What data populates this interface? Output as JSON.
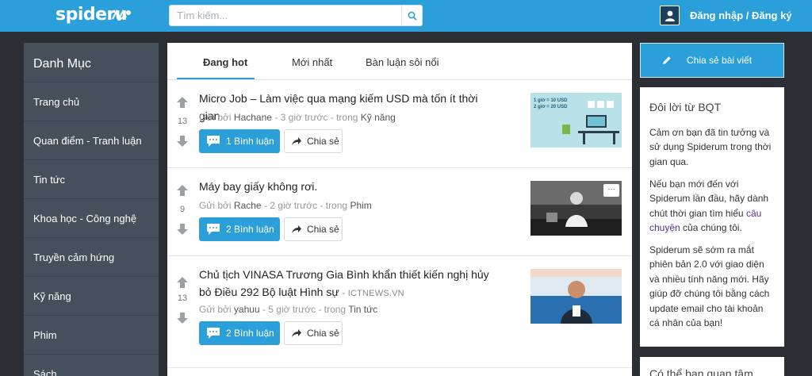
{
  "header": {
    "logo_text": "spideru",
    "search_placeholder": "Tìm kiếm...",
    "search_icon": "search-icon",
    "user_icon": "user-avatar-icon",
    "login_label": "Đăng nhập / Đăng ký",
    "brand_color": "#2b9fd9"
  },
  "sidebar": {
    "title": "Danh Mục",
    "items": [
      {
        "label": "Trang chủ"
      },
      {
        "label": "Quan điểm - Tranh luận"
      },
      {
        "label": "Tin tức"
      },
      {
        "label": "Khoa học - Công nghệ"
      },
      {
        "label": "Truyền cảm hứng"
      },
      {
        "label": "Kỹ năng"
      },
      {
        "label": "Phim"
      },
      {
        "label": "Sách"
      }
    ]
  },
  "tabs": [
    {
      "label": "Đang hot",
      "active": true
    },
    {
      "label": "Mới nhất",
      "active": false
    },
    {
      "label": "Bàn luận sôi nổi",
      "active": false
    }
  ],
  "posts": [
    {
      "title": "Micro Job – Làm việc qua mạng kiếm USD mà tốn ít thời gian",
      "votes": "13",
      "by_label": "Gửi bởi",
      "author": "Hachane",
      "time": "- 3 giờ trước - trong",
      "category": "Kỹ năng",
      "comments_label": "1 Bình luận",
      "share_label": "Chia sẻ",
      "thumb_text_1": "1 giờ = 10 USD",
      "thumb_text_2": "2 giờ = 20 USD"
    },
    {
      "title": "Máy bay giấy không rơi.",
      "votes": "9",
      "by_label": "Gửi bởi",
      "author": "Rache",
      "time": "- 2 giờ trước - trong",
      "category": "Phim",
      "comments_label": "2 Bình luận",
      "share_label": "Chia sẻ",
      "thumb_more": "···"
    },
    {
      "title": "Chủ tịch VINASA Trương Gia Bình khẩn thiết kiến nghị hủy bỏ Điều 292 Bộ luật Hình sự",
      "source": "- ICTNEWS.VN",
      "votes": "13",
      "by_label": "Gửi bởi",
      "author": "yahuu",
      "time": "- 5 giờ trước - trong",
      "category": "Tin tức",
      "comments_label": "2 Bình luận",
      "share_label": "Chia sẻ"
    }
  ],
  "right": {
    "share_post_label": "Chia sẻ bài viết",
    "bqt_title": "Đôi lời từ BQT",
    "p1_lines": [
      "Cảm ơn bạn đã tin tưởng và",
      "sử dụng Spiderum trong thời",
      "gian qua."
    ],
    "p2_lines": [
      "Nếu bạn mới đến với",
      "Spiderum lần đầu, hãy dành",
      "chút thời gian tìm hiểu"
    ],
    "p2_link_a": "câu",
    "p2_link_b": "chuyện",
    "p2_tail": "của chúng tôi.",
    "p3_lines": [
      "Spiderum sẽ sớm ra mắt",
      "phiên bản 2.0 với giao diện",
      "và nhiều tính năng mới. Hãy",
      "giúp đỡ chúng tôi bằng cách",
      "update email cho tài khoản",
      "cá nhân của bạn!"
    ],
    "maybe_title": "Có thể bạn quan tâm"
  }
}
